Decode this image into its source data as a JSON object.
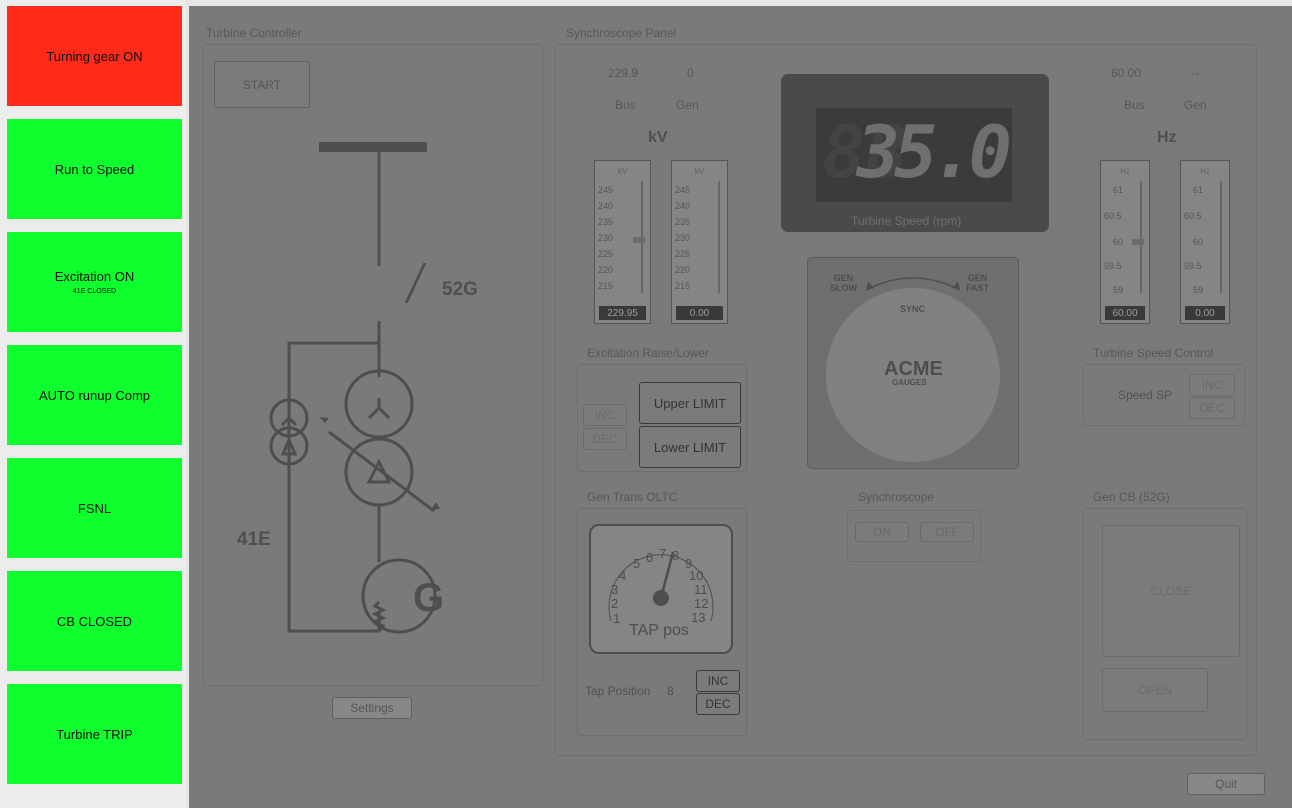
{
  "sidebar": {
    "buttons": [
      {
        "label": "Turning gear ON",
        "sub": ""
      },
      {
        "label": "Run to Speed",
        "sub": ""
      },
      {
        "label": "Excitation ON",
        "sub": "41E CLOSED"
      },
      {
        "label": "AUTO runup Comp",
        "sub": ""
      },
      {
        "label": "FSNL",
        "sub": ""
      },
      {
        "label": "CB CLOSED",
        "sub": ""
      },
      {
        "label": "Turbine TRIP",
        "sub": ""
      }
    ]
  },
  "turbine_controller": {
    "title": "Turbine Controller",
    "start_label": "START",
    "breaker_52g": "52G",
    "breaker_41e": "41E",
    "generator_label": "G",
    "settings_label": "Settings"
  },
  "synchroscope_panel": {
    "title": "Synchroscope Panel",
    "bus_kv": "229.9",
    "gen_kv": "0",
    "bus_label": "Bus",
    "gen_label": "Gen",
    "kv_unit": "kV",
    "bus_hz": "60.00",
    "gen_hz": "--",
    "hz_unit": "Hz",
    "kv_ticks": [
      "245",
      "240",
      "235",
      "230",
      "225",
      "220",
      "215"
    ],
    "hz_ticks": [
      "61",
      "60.5",
      "60",
      "59.5",
      "59"
    ],
    "kv_meter_bus_value": "229.95",
    "kv_meter_gen_value": "0.00",
    "hz_meter_bus_value": "60.00",
    "hz_meter_gen_value": "0.00",
    "speed_display_dim": "88",
    "speed_display": "35.0",
    "speed_label": "Turbine Speed (rpm)",
    "scope_gen_slow": "GEN\nSLOW",
    "scope_gen_fast": "GEN\nFAST",
    "scope_sync": "SYNC",
    "scope_brand": "ACME",
    "scope_brand_sub": "GAUGES"
  },
  "excitation": {
    "title": "Excitation Raise/Lower",
    "inc": "INC",
    "dec": "DEC",
    "upper_limit": "Upper LIMIT",
    "lower_limit": "Lower LIMIT"
  },
  "speed_control": {
    "title": "Turbine Speed Control",
    "label": "Speed SP",
    "inc": "INC",
    "dec": "DEC"
  },
  "oltc": {
    "title": "Gen Trans OLTC",
    "gauge_label": "TAP pos",
    "gauge_ticks": [
      "1",
      "2",
      "3",
      "4",
      "5",
      "6",
      "7",
      "8",
      "9",
      "10",
      "11",
      "12",
      "13"
    ],
    "tap_label": "Tap Position",
    "tap_value": "8",
    "inc": "INC",
    "dec": "DEC"
  },
  "synchroscope": {
    "title": "Synchroscope",
    "on": "ON",
    "off": "OFF"
  },
  "gen_cb": {
    "title": "Gen CB (52G)",
    "close": "CLOSE",
    "open": "OPEN"
  },
  "quit_label": "Quit",
  "colors": {
    "red": "#ff2a1a",
    "green": "#0fff2e",
    "overlay": "#7a7a7a"
  }
}
